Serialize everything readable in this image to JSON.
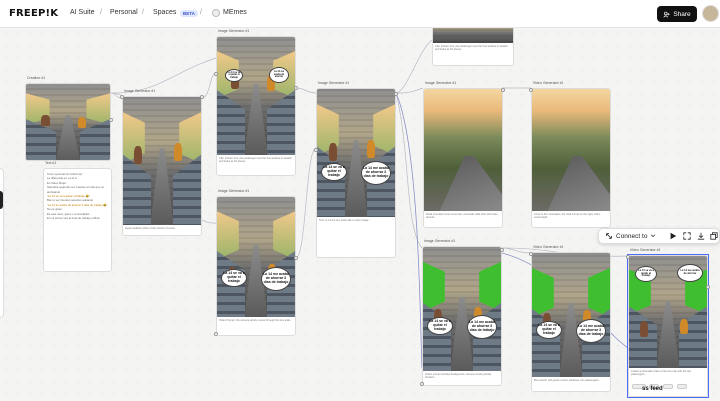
{
  "header": {
    "logo": "FREEP!K",
    "breadcrumbs": [
      "AI Suite",
      "Personal",
      "Spaces"
    ],
    "separator": "/",
    "beta_badge": "BETA",
    "space_name": "MEmes",
    "share_label": "Share"
  },
  "nodes": {
    "creation_title": "Creation #1",
    "text_title": "Text #1",
    "image_gen_title": "Image Generator #1",
    "video_gen_title": "Video Generator #1"
  },
  "text_node": {
    "lines": [
      "Texto opcional (si incluimos):",
      "La diferencia es: es el 3.",
      "En Video Bruja:",
      "Narrativa segunda vez maestro el más que un ambulanté",
      "\"La 14 se va a quitar el trabajo 😂\"",
      "Bien a ver intentan sacarlos adelante",
      "\"La 14 se acabo de ahorrar 3 días de trabajo 😂\"",
      "No se quién",
      "Es este caos, gana o convocables",
      "En mi primer ves la hora de trabajo el Bus!"
    ]
  },
  "bubbles": {
    "a1": "La 14 se va a quitar el trabajo",
    "a2": "La 14 me acaba de ahorrar 3 días de trabajo",
    "b1": "La 14 se va a quitar el trabajo",
    "b2": "La 14 me acaba de ahorrar 3 días de trabajo",
    "small1": "La 14 se va a quitar el trabajo",
    "small2": "La 14 me acaba de ahorrar"
  },
  "captions": {
    "c1": "Clip: Interior bus, the passenger near the bus window is seated and looks at his phone...",
    "c2": "Video Prompt: the camera slowly moves through the bus aisle...",
    "c3": "Hyper-realistic photo of the interior of a bus...",
    "c4": "Text: In 14 the sun looks like a crazy image ...",
    "c5": "Road mountain curve at sunset, cinematic wide shot with trees around...",
    "c6": "A bus in the mountains, the road curves to the right, warm sunset light...",
    "c7": "Green screen window background, camera moving slowly forward...",
    "c8": "Bus interior with green screen windows, two passengers...",
    "c9": "Create a cinematic video of the bus ride with the two passengers..."
  },
  "toolbar": {
    "connect_label": "Connect to",
    "connect_icon": "connect-icon",
    "chevron_icon": "chevron-down-icon",
    "play_icon": "play-icon",
    "expand_icon": "expand-icon",
    "download_icon": "download-icon",
    "duplicate_icon": "duplicate-icon"
  },
  "footer": {
    "feed_label": "ss feed"
  },
  "colors": {
    "accent": "#4a6cf7",
    "share_bg": "#111111",
    "beta_bg": "#dfe7ff",
    "green_screen": "#3fbf2f"
  }
}
